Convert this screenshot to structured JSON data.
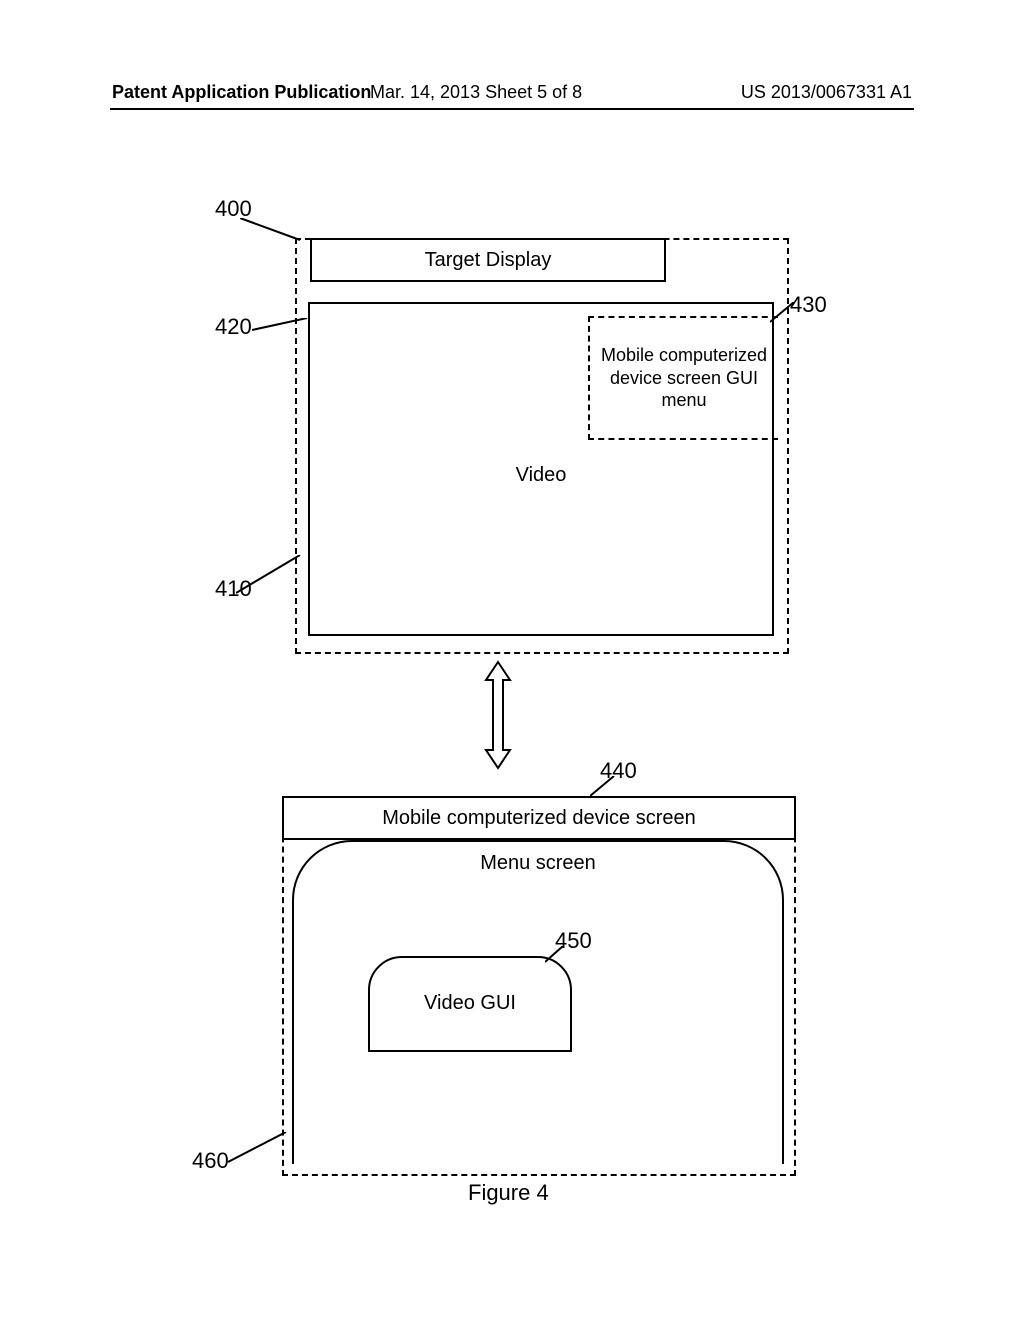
{
  "header": {
    "left": "Patent Application Publication",
    "mid": "Mar. 14, 2013  Sheet 5 of 8",
    "right": "US 2013/0067331 A1"
  },
  "refs": {
    "r400": "400",
    "r410": "410",
    "r420": "420",
    "r430": "430",
    "r440": "440",
    "r450": "450",
    "r460": "460"
  },
  "labels": {
    "target_display": "Target Display",
    "mobile_gui_menu": "Mobile computerized device screen GUI menu",
    "video": "Video",
    "mobile_screen": "Mobile computerized device  screen",
    "menu_screen": "Menu screen",
    "video_gui": "Video GUI",
    "figure": "Figure 4"
  }
}
